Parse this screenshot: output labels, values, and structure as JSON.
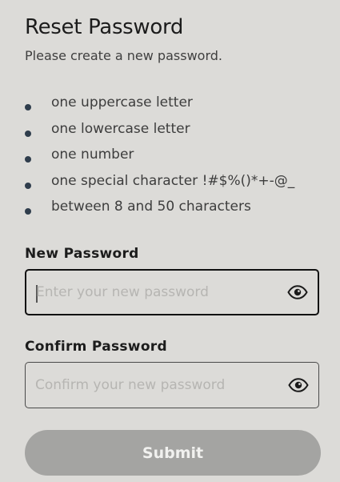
{
  "header": {
    "title": "Reset Password",
    "subtitle": "Please create a new password."
  },
  "requirements": [
    "one uppercase letter",
    "one lowercase letter",
    "one number",
    "one special character !#$%()*+-@_",
    "between 8 and 50 characters"
  ],
  "new_password": {
    "label": "New Password",
    "value": "",
    "placeholder": "Enter your new password",
    "visibility_icon": "eye-icon"
  },
  "confirm_password": {
    "label": "Confirm Password",
    "value": "",
    "placeholder": "Confirm your new password",
    "visibility_icon": "eye-icon"
  },
  "submit": {
    "label": "Submit"
  },
  "colors": {
    "background": "#dcdbd8",
    "bullet": "#2f3d4c",
    "submit_disabled": "#a4a4a2"
  }
}
